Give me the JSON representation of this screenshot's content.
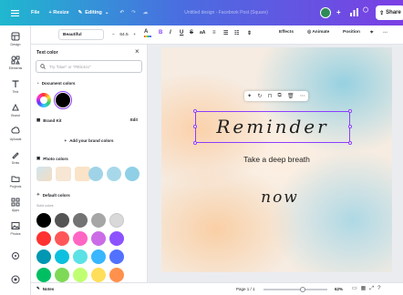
{
  "topbar": {
    "file": "File",
    "resize": "+ Resize",
    "editing": "Editing",
    "title": "Untitled design - Facebook Post (Square)",
    "share": "Share"
  },
  "rail": [
    {
      "label": "Design",
      "icon": "design-icon"
    },
    {
      "label": "Elements",
      "icon": "elements-icon"
    },
    {
      "label": "Text",
      "icon": "text-icon"
    },
    {
      "label": "Brand",
      "icon": "brand-icon"
    },
    {
      "label": "Uploads",
      "icon": "uploads-icon"
    },
    {
      "label": "Draw",
      "icon": "draw-icon"
    },
    {
      "label": "Projects",
      "icon": "projects-icon"
    },
    {
      "label": "Apps",
      "icon": "apps-icon"
    },
    {
      "label": "Photos",
      "icon": "photos-icon"
    }
  ],
  "toolbar": {
    "font": "Beautiful",
    "size": "64.5",
    "effects": "Effects",
    "animate": "Animate",
    "position": "Position"
  },
  "panel": {
    "title": "Text color",
    "search_placeholder": "Try \"blue\" or \"#00c4cc\"",
    "document_colors": "Document colors",
    "brand_kit": "Brand Kit",
    "edit": "Edit",
    "add_brand_colors": "Add your brand colors",
    "photo_colors": "Photo colors",
    "default_colors": "Default colors",
    "solid_colors": "Solid colors",
    "doc_swatches": [
      "#000000"
    ],
    "photo_swatches": [
      "#9fd4e8",
      "#a7d8ea",
      "#8fd0e6",
      "#7cc8e3"
    ],
    "photo_thumbs": [
      "#cfe6ee",
      "#f4dcc2",
      "#fbe3c8"
    ],
    "default_swatches": [
      [
        "#000000",
        "#545454",
        "#737373",
        "#a6a6a6",
        "#d9d9d9"
      ],
      [
        "#ff3131",
        "#ff5757",
        "#ff66c4",
        "#cb6ce6",
        "#8c52ff"
      ],
      [
        "#0097b2",
        "#0cc0df",
        "#5ce1e6",
        "#38b6ff",
        "#5271ff"
      ],
      [
        "#00bf63",
        "#7ed957",
        "#c1ff72",
        "#ffde59",
        "#ff914d"
      ]
    ]
  },
  "canvas": {
    "headline": "Reminder",
    "subtitle": "Take a deep breath",
    "closing": "now"
  },
  "bottombar": {
    "notes": "Notes",
    "page": "Page 1 / 1",
    "zoom_percent": 62,
    "zoom": "62%"
  },
  "colors": {
    "selection": "#8b3dff",
    "rail_bg": "#ffffff",
    "workspace": "#ebecf0"
  }
}
